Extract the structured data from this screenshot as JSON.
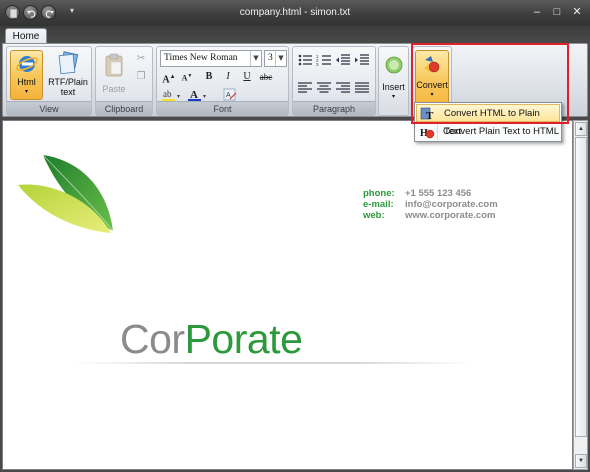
{
  "window": {
    "title": "company.html - simon.txt"
  },
  "titlebar": {
    "minimize": "–",
    "maximize": "□",
    "close": "✕"
  },
  "ribbon": {
    "tabs": [
      {
        "label": "Home"
      }
    ],
    "groups": {
      "view": {
        "label": "View",
        "html_label": "Html",
        "rtf_label_1": "RTF/Plain",
        "rtf_label_2": "text"
      },
      "clipboard": {
        "label": "Clipboard",
        "paste_label": "Paste"
      },
      "font": {
        "label": "Font",
        "font_name": "Times New Roman",
        "font_size": "3"
      },
      "paragraph": {
        "label": "Paragraph"
      },
      "insert": {
        "label": "Insert"
      },
      "convert": {
        "label": "Convert"
      }
    }
  },
  "dropdown": {
    "items": [
      {
        "label": "Convert HTML to Plain Text",
        "highlighted": true
      },
      {
        "label": "Convert Plain Text to HTML",
        "highlighted": false
      }
    ]
  },
  "document": {
    "logo": {
      "part1": "Cor",
      "part2": "Porate"
    },
    "contact": [
      {
        "key": "phone:",
        "value": "+1 555 123 456"
      },
      {
        "key": "e-mail:",
        "value": "info@corporate.com"
      },
      {
        "key": "web:",
        "value": "www.corporate.com"
      }
    ]
  },
  "colors": {
    "brand_green": "#2c9a3a",
    "brand_gray": "#8b8b8b",
    "highlight_red": "#e0202a",
    "accent_orange": "#f4b23b"
  }
}
